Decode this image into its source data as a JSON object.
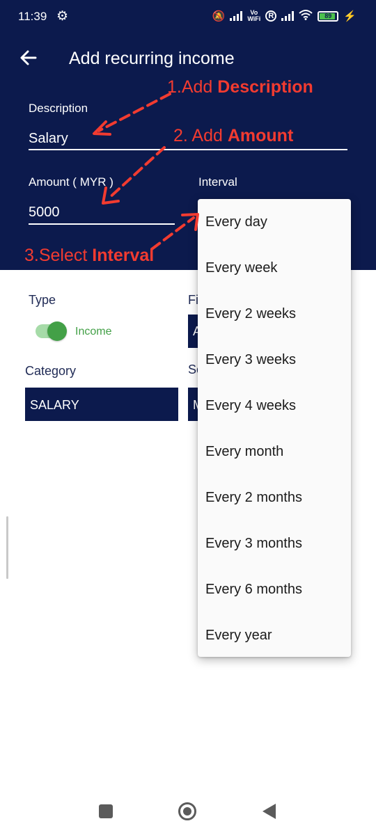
{
  "status_bar": {
    "time": "11:39",
    "vowifi_top": "Vo",
    "vowifi_bottom": "WiFi",
    "roaming": "R",
    "battery_level": "89"
  },
  "app_bar": {
    "title": "Add recurring income"
  },
  "form": {
    "description_label": "Description",
    "description_value": "Salary",
    "amount_label": "Amount ( MYR )",
    "amount_value": "5000",
    "interval_label": "Interval",
    "type_label": "Type",
    "type_toggle_text": "Income",
    "type_toggle_on": true,
    "first_label_partial": "Fi",
    "first_value_partial": "A",
    "category_label": "Category",
    "category_value": "SALARY",
    "second_label_partial": "Se",
    "second_value_partial": "M"
  },
  "annotations": {
    "step1_prefix": "1.Add ",
    "step1_bold": "Description",
    "step2_prefix": "2. Add ",
    "step2_bold": "Amount",
    "step3_prefix": "3.Select ",
    "step3_bold": "Interval",
    "color": "#f23b30"
  },
  "interval_options": [
    "Every day",
    "Every week",
    "Every 2 weeks",
    "Every 3 weeks",
    "Every 4 weeks",
    "Every month",
    "Every 2 months",
    "Every 3 months",
    "Every 6 months",
    "Every year"
  ],
  "colors": {
    "header_bg": "#0c1a4d",
    "toggle_green": "#43a047",
    "annotation_red": "#f23b30"
  }
}
